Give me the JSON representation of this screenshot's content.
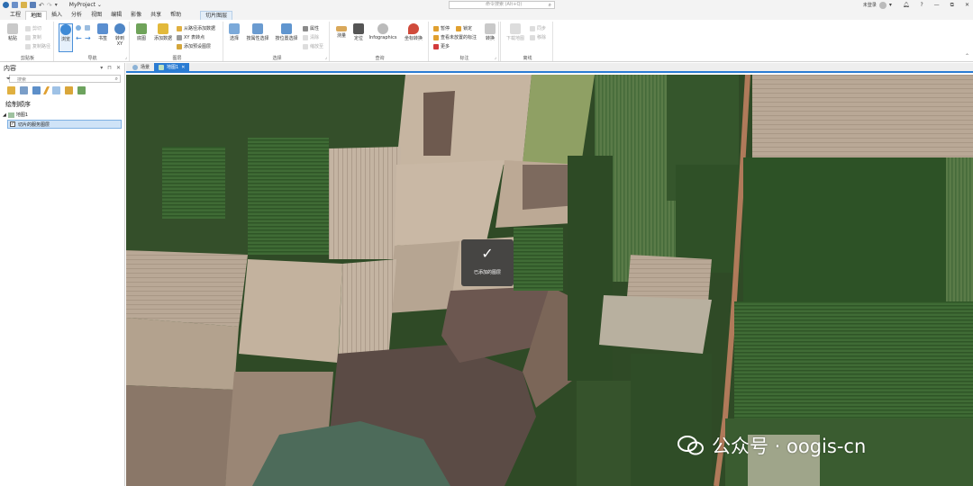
{
  "titlebar": {
    "project_name": "MyProject ⌄",
    "search_placeholder": "命令搜索 (Alt+Q)",
    "user_name": "未登录",
    "window_controls": [
      "—",
      "⧉",
      "✕"
    ]
  },
  "ribbon_tabs": [
    {
      "label": "工程",
      "active": false
    },
    {
      "label": "地图",
      "active": true
    },
    {
      "label": "插入",
      "active": false
    },
    {
      "label": "分析",
      "active": false
    },
    {
      "label": "视图",
      "active": false
    },
    {
      "label": "编辑",
      "active": false
    },
    {
      "label": "影像",
      "active": false
    },
    {
      "label": "共享",
      "active": false
    },
    {
      "label": "帮助",
      "active": false
    }
  ],
  "contextual_tab": "切片图层",
  "ribbon": {
    "clipboard": {
      "label": "剪贴板",
      "paste": "粘贴",
      "cut": "剪切",
      "copy": "复制",
      "copy_path": "复制路径"
    },
    "navigate": {
      "label": "导航",
      "explore": "浏览",
      "bookmarks": "书签",
      "goto": "转到 XY"
    },
    "layer": {
      "label": "图层",
      "basemap": "底图",
      "add_data": "添加数据",
      "add_from_path": "从路径添加数据",
      "xy_table": "XY 表转点",
      "add_preset": "添加预设图层"
    },
    "selection": {
      "label": "选择",
      "select": "选择",
      "by_attr": "按属性选择",
      "by_location": "按位置选择",
      "attributes": "属性",
      "clear": "清除",
      "zoom_to": "缩放至"
    },
    "inquiry": {
      "label": "查询",
      "measure": "测量",
      "locate": "定位",
      "infographics": "Infographics",
      "coord_convert": "坐标转换"
    },
    "labeling": {
      "label": "标注",
      "pause": "暂停",
      "lock": "锁定",
      "view_unplaced": "查看未放置的标注",
      "more": "更多"
    },
    "convert": {
      "label": "",
      "convert_btn": "转换"
    },
    "offline": {
      "label": "离线",
      "download_map": "下载地图",
      "sync": "同步",
      "remove": "移除"
    }
  },
  "contents_pane": {
    "title": "内容",
    "search_placeholder": "搜索",
    "draw_order_label": "绘制顺序",
    "map_name": "地图1",
    "layer_name": "切片的服务图层",
    "layer_checked": true
  },
  "doc_tabs": [
    {
      "label": "场景",
      "active": false
    },
    {
      "label": "地图1",
      "active": true
    }
  ],
  "toast": {
    "message": "已添加的图层"
  },
  "watermark": {
    "text": "公众号 · oogis-cn"
  },
  "colors": {
    "accent": "#2b7cd3",
    "selection_bg": "#cfe3f7",
    "toast_bg": "#3c3c3c"
  }
}
